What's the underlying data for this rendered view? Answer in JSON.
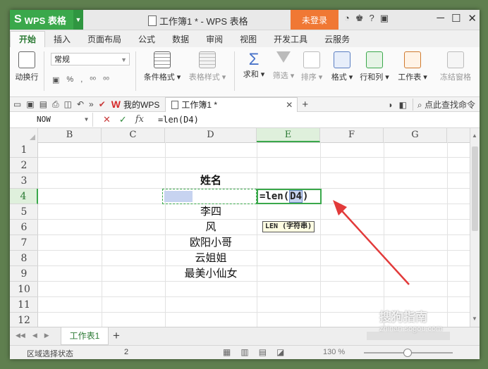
{
  "app": {
    "name": "WPS 表格",
    "doc_title": "工作簿1 * - WPS 表格",
    "login": "未登录"
  },
  "title_icons": [
    "◔",
    "♚",
    "?",
    "▣"
  ],
  "window_controls": [
    "─",
    "☐",
    "✕"
  ],
  "ribbon_tabs": [
    "开始",
    "插入",
    "页面布局",
    "公式",
    "数据",
    "审阅",
    "视图",
    "开发工具",
    "云服务"
  ],
  "ribbon": {
    "wrap": "动换行",
    "number_format": "常规",
    "percent": "%",
    "decimals": "⁰⁰",
    "buttons": [
      "条件格式",
      "表格样式",
      "求和",
      "筛选",
      "排序",
      "格式",
      "行和列",
      "工作表",
      "冻结窗格"
    ]
  },
  "quick_access": {
    "my_wps": "我的WPS",
    "doc_tab": "工作簿1 *",
    "find_cmd": "点此查找命令"
  },
  "formula_bar": {
    "name_box": "NOW",
    "formula": "=len(D4)"
  },
  "grid": {
    "columns": [
      "B",
      "C",
      "D",
      "E",
      "F",
      "G"
    ],
    "selected_column": "E",
    "rows": [
      "1",
      "2",
      "3",
      "4",
      "5",
      "6",
      "7",
      "8",
      "9",
      "10",
      "11",
      "12"
    ],
    "selected_row": "4",
    "header_cell": "姓名",
    "names": [
      "李四",
      "风",
      "欧阳小哥",
      "云姐姐",
      "最美小仙女"
    ],
    "edit_prefix": "=len(",
    "edit_ref": "D4",
    "edit_suffix": ")",
    "tooltip": "LEN (字符串)"
  },
  "sheet": {
    "tab": "工作表1"
  },
  "status": {
    "text": "区域选择状态",
    "count": "2",
    "zoom": "130 %"
  },
  "watermark": {
    "brand": "搜狗指南",
    "url": "zhinan.sogou.com"
  }
}
